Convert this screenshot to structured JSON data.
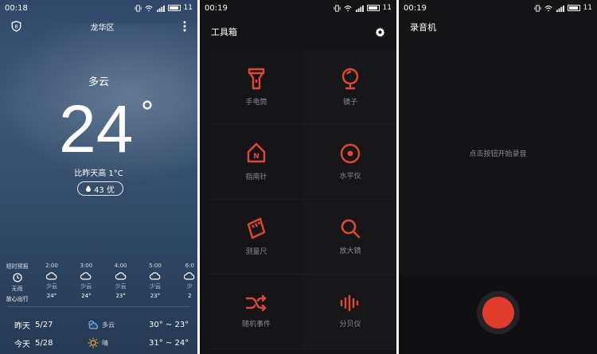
{
  "accent_color": "#e2472f",
  "status_bars": [
    {
      "time": "00:18",
      "battery": "11"
    },
    {
      "time": "00:19",
      "battery": "11"
    },
    {
      "time": "00:19",
      "battery": "11"
    }
  ],
  "weather": {
    "district": "龙华区",
    "condition": "多云",
    "temperature": "24",
    "degree": "°",
    "compare": "比昨天高 1°C",
    "aqi": "43 优",
    "hourly": [
      {
        "time": "短时预报",
        "cond": "无雨",
        "temp": "放心出行",
        "icon": "clock-icon"
      },
      {
        "time": "2:00",
        "cond": "少云",
        "temp": "24°",
        "icon": "cloud-icon"
      },
      {
        "time": "3:00",
        "cond": "少云",
        "temp": "24°",
        "icon": "cloud-icon"
      },
      {
        "time": "4:00",
        "cond": "少云",
        "temp": "23°",
        "icon": "cloud-icon"
      },
      {
        "time": "5:00",
        "cond": "少云",
        "temp": "23°",
        "icon": "cloud-icon"
      },
      {
        "time": "6:0",
        "cond": "少",
        "temp": "2",
        "icon": "cloud-icon"
      }
    ],
    "daily": [
      {
        "day": "昨天",
        "date": "5/27",
        "cond": "多云",
        "range": "30° ~ 23°",
        "icon": "cloud-sun-icon"
      },
      {
        "day": "今天",
        "date": "5/28",
        "cond": "晴",
        "range": "31° ~ 24°",
        "icon": "sun-icon"
      }
    ]
  },
  "toolbox": {
    "title": "工具箱",
    "tools": [
      {
        "label": "手电筒",
        "icon": "flashlight-icon"
      },
      {
        "label": "镜子",
        "icon": "mirror-icon"
      },
      {
        "label": "指南针",
        "icon": "compass-icon"
      },
      {
        "label": "水平仪",
        "icon": "level-icon"
      },
      {
        "label": "测量尺",
        "icon": "ruler-icon"
      },
      {
        "label": "放大镜",
        "icon": "magnifier-icon"
      },
      {
        "label": "随机事件",
        "icon": "shuffle-icon"
      },
      {
        "label": "分贝仪",
        "icon": "decibel-icon"
      }
    ]
  },
  "recorder": {
    "title": "录音机",
    "hint": "点击按钮开始录音"
  }
}
